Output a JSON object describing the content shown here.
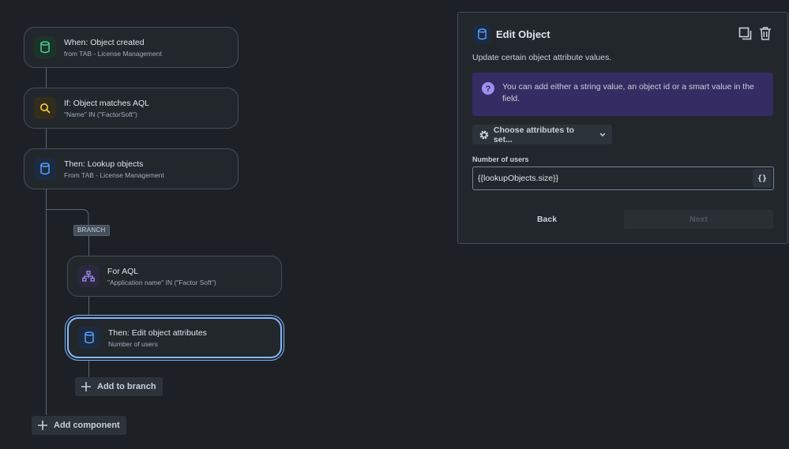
{
  "flow": {
    "nodes": [
      {
        "title": "When: Object created",
        "subtitle": "from TAB - License Management",
        "icon": "database-icon"
      },
      {
        "title": "If: Object matches AQL",
        "subtitle": "\"Name\" IN (\"FactorSoft\")",
        "icon": "search-icon"
      },
      {
        "title": "Then: Lookup objects",
        "subtitle": "From TAB - License Management",
        "icon": "database-icon"
      },
      {
        "title": "For AQL",
        "subtitle": "\"Application name\" IN (\"Factor Soft\")",
        "icon": "hierarchy-icon"
      },
      {
        "title": "Then: Edit object attributes",
        "subtitle": "Number of users",
        "icon": "database-icon"
      }
    ],
    "branch_tag": "BRANCH",
    "add_to_branch": "Add to branch",
    "add_component": "Add component"
  },
  "panel": {
    "title": "Edit Object",
    "description": "Update certain object attribute values.",
    "info": "You can add either a string value, an object id or a smart value in the field.",
    "choose_attributes": "Choose attributes to set...",
    "field_label": "Number of users",
    "field_value": "{{lookupObjects.size}}",
    "smart_value_button": "{}",
    "back": "Back",
    "next": "Next"
  },
  "colors": {
    "background": "#1d2125",
    "card": "#22272b",
    "selected_border": "#85b8ff",
    "info_background": "#352c63",
    "info_icon": "#9f8fef"
  }
}
